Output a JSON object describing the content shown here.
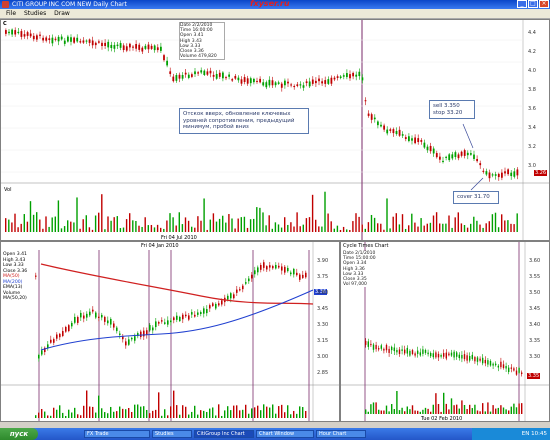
{
  "window": {
    "title": "CITI GROUP INC COM NEW Daily Chart",
    "brand": "fxyser.ru",
    "buttons": [
      "_",
      "□",
      "×"
    ]
  },
  "menu": [
    "File",
    "Studies",
    "Draw"
  ],
  "main_chart": {
    "symbol": "C",
    "info_lines": [
      "Date 2/2/2010",
      "Time 16:00:00",
      "Open 3.41",
      "High 3.43",
      "Low 3.33",
      "Close 3.36",
      "Volume 479,820"
    ],
    "annotation": "Отскок вверх, обновление ключевых уровней сопротивления, предыдущий минимум, пробой вниз",
    "sell_label": "sell 3.350\nstop 33.20",
    "cover_label": "cover 31.70",
    "price_levels": [
      "4.4",
      "4.2",
      "4.0",
      "3.8",
      "3.6",
      "3.4",
      "3.2",
      "3.0"
    ],
    "last_price": "3.26",
    "volume_label": "Vol",
    "date_range": "Fri 04 Jul 2010"
  },
  "left_chart": {
    "legend": [
      "Open 3.41",
      "High 3.43",
      "Low 3.33",
      "Close 3.36",
      "MA(50)",
      "MA(200)",
      "EMA(13)",
      "Volume",
      "MA(50,20)"
    ],
    "price_levels": [
      "3.90",
      "3.75",
      "3.60",
      "3.45",
      "3.30",
      "3.15",
      "3.00",
      "2.85"
    ],
    "last_price": "3.36",
    "date_range": "Fri 04 Jan 2010"
  },
  "right_chart": {
    "title": "Cycle Times Chart",
    "info_lines": [
      "Date 2/1/2010",
      "Time 15:00:00",
      "Open 3.34",
      "High 3.36",
      "Low 3.33",
      "Close 3.35",
      "Vol 97,000"
    ],
    "price_levels": [
      "3.60",
      "3.55",
      "3.50",
      "3.45",
      "3.40",
      "3.35",
      "3.30"
    ],
    "last_price": "3.35",
    "date_range": "Tue 02 Feb 2010"
  },
  "taskbar": {
    "start": "пуск",
    "items": [
      "FX Trade",
      "Studies",
      "CitiGroup Inc Chart",
      "Chart Window",
      "Hour Chart"
    ],
    "tray_time": "EN 10:45"
  },
  "colors": {
    "up_candle": "#00a000",
    "down_candle": "#c00000",
    "ma_red": "#d02020",
    "ma_blue": "#2040d0",
    "cycle_line": "#7a2a6a"
  }
}
